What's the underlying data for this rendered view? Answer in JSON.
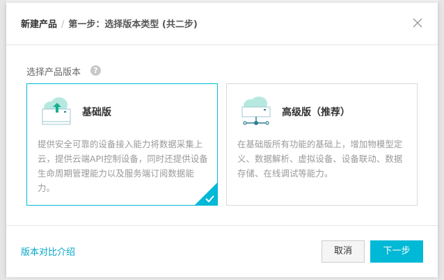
{
  "header": {
    "breadcrumb_root": "新建产品",
    "separator": "/",
    "step_title": "第一步：选择版本类型 (共二步)"
  },
  "section": {
    "label": "选择产品版本",
    "help_glyph": "?"
  },
  "cards": [
    {
      "title": "基础版",
      "description": "提供安全可靠的设备接入能力将数据采集上云，提供云端API控制设备，同时还提供设备生命周期管理能力以及服务端订阅数据能力。",
      "selected": true,
      "icon": "cloud-upload-icon"
    },
    {
      "title": "高级版（推荐）",
      "description": "在基础版所有功能的基础上，增加物模型定义、数据解析、虚拟设备、设备联动、数据存储、在线调试等能力。",
      "selected": false,
      "icon": "cloud-network-icon"
    }
  ],
  "footer": {
    "compare_link": "版本对比介绍",
    "cancel_label": "取消",
    "next_label": "下一步"
  },
  "colors": {
    "accent": "#00b9d6",
    "link": "#00a7c8",
    "icon_teal": "#b6e8e0"
  }
}
